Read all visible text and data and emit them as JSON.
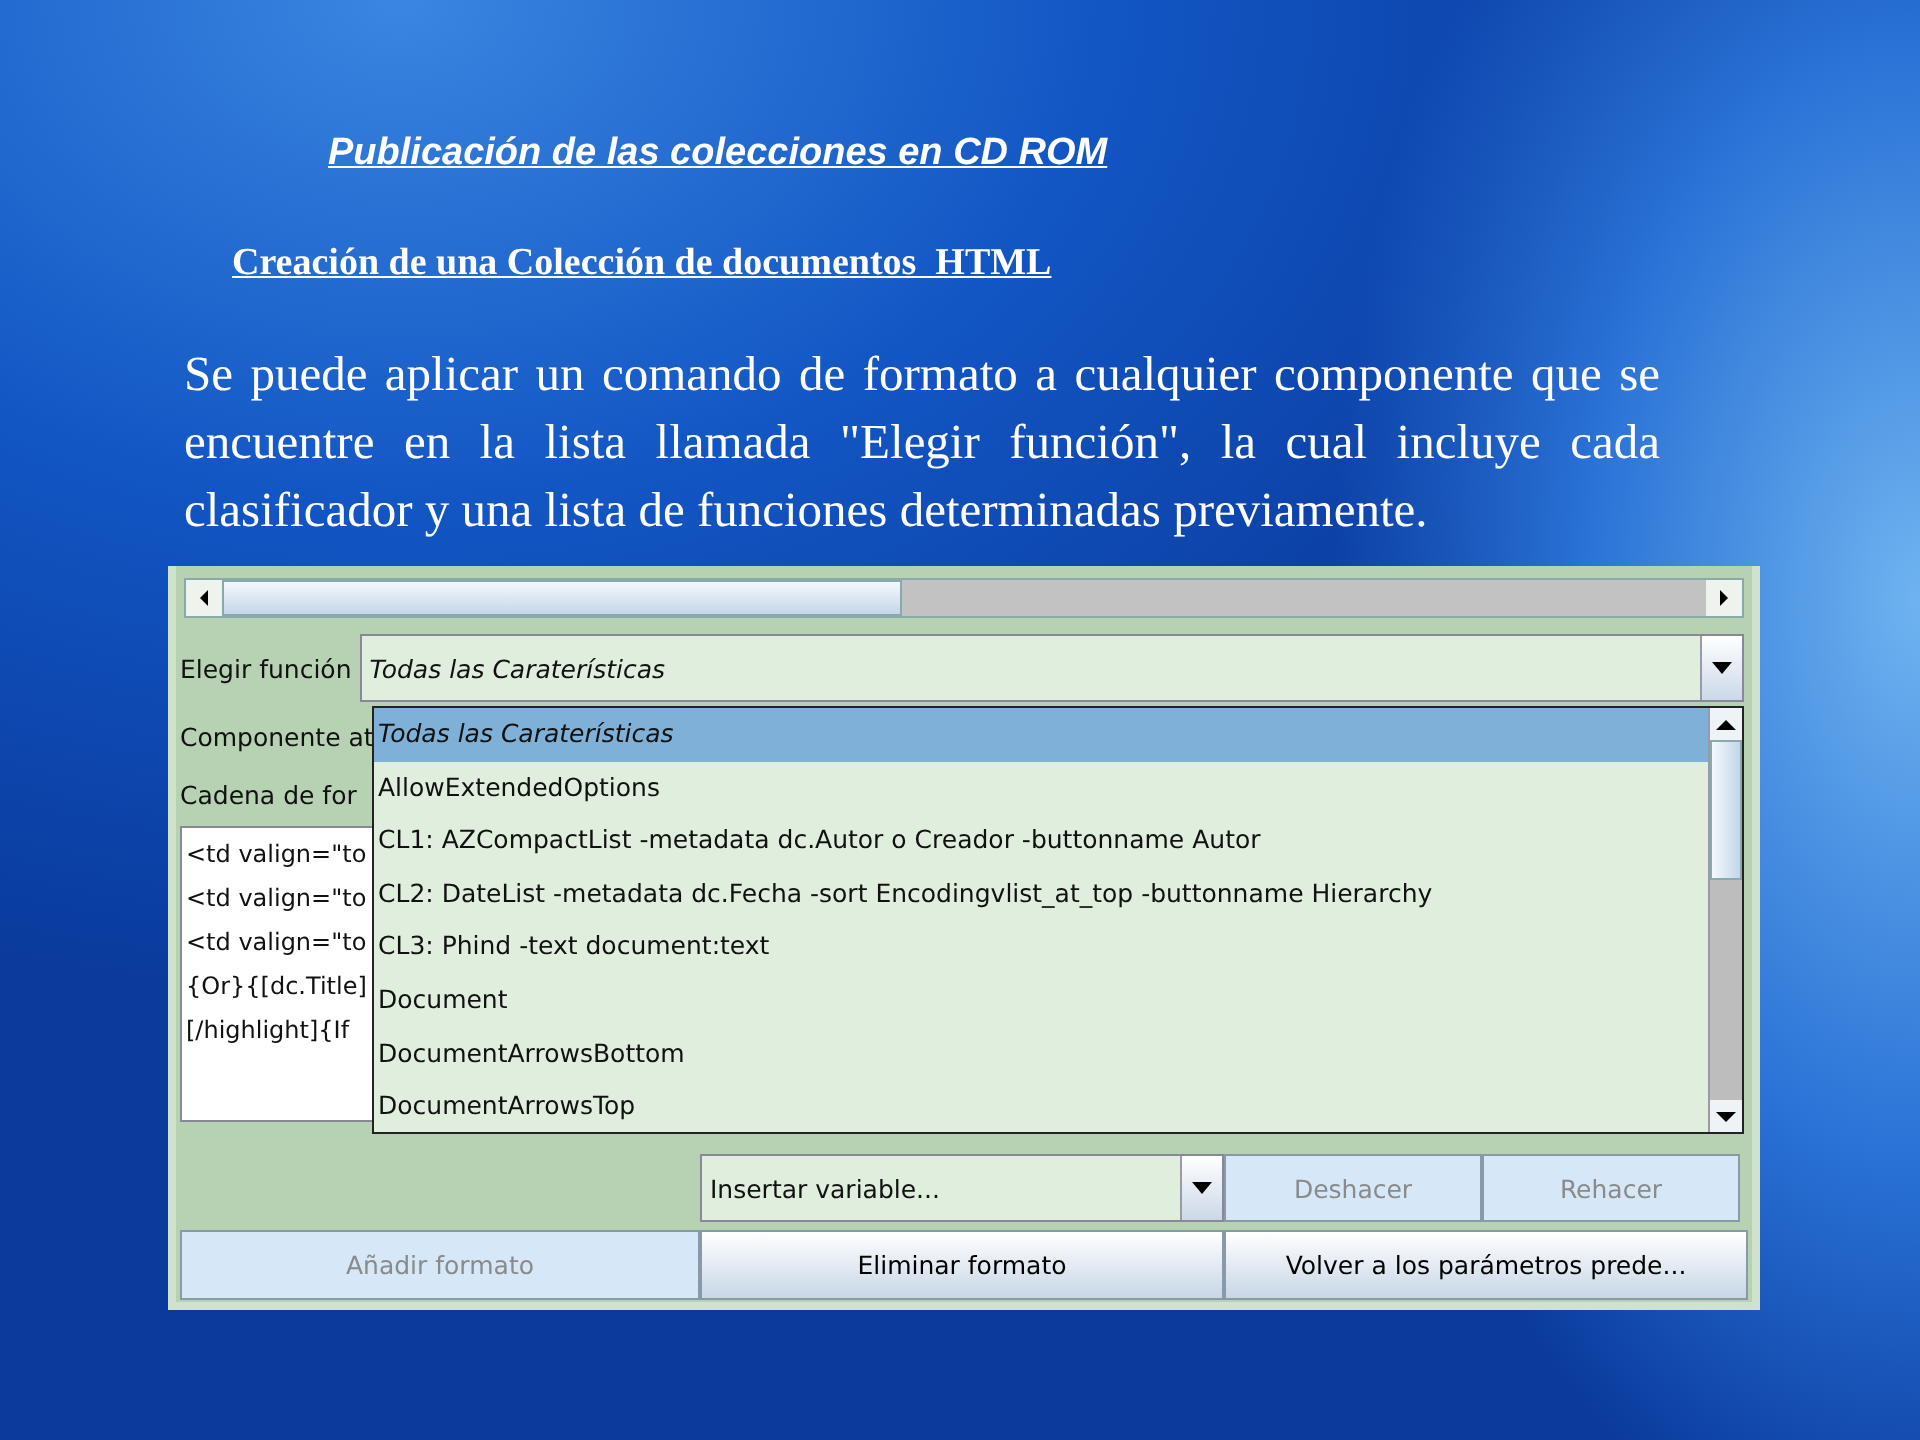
{
  "slide": {
    "title": "Publicación de las colecciones en CD ROM",
    "subtitle": "Creación de una Colección de documentos  HTML",
    "body": "Se puede aplicar un comando de formato a cualquier componente que se encuentre en la lista llamada \"Elegir función\", la cual incluye cada clasificador y una lista de funciones determinadas previamente."
  },
  "app": {
    "function_label": "Elegir función",
    "function_value": "Todas las Caraterísticas",
    "side_labels": [
      "Componente at",
      "Cadena de for"
    ],
    "format_lines": [
      "<td valign=\"to",
      "<td valign=\"to",
      "<td valign=\"to",
      "{Or}{[dc.Title]",
      "[/highlight]{If"
    ],
    "dropdown_items": [
      {
        "label": "Todas las Caraterísticas",
        "selected": true
      },
      {
        "label": "AllowExtendedOptions",
        "selected": false
      },
      {
        "label": "CL1:  AZCompactList -metadata dc.Autor o Creador -buttonname Autor",
        "selected": false
      },
      {
        "label": "CL2:  DateList -metadata dc.Fecha -sort Encodingvlist_at_top -buttonname Hierarchy",
        "selected": false
      },
      {
        "label": "CL3:  Phind -text document:text",
        "selected": false
      },
      {
        "label": "Document",
        "selected": false
      },
      {
        "label": "DocumentArrowsBottom",
        "selected": false
      },
      {
        "label": "DocumentArrowsTop",
        "selected": false
      }
    ],
    "variable_combo": "Insertar variable...",
    "edit_buttons": [
      {
        "label": "Deshacer",
        "disabled": true
      },
      {
        "label": "Rehacer",
        "disabled": true
      }
    ],
    "action_buttons": [
      {
        "label": "Añadir formato",
        "disabled": true
      },
      {
        "label": "Eliminar formato",
        "disabled": false
      },
      {
        "label": "Volver a los parámetros prede...",
        "disabled": false
      }
    ]
  }
}
